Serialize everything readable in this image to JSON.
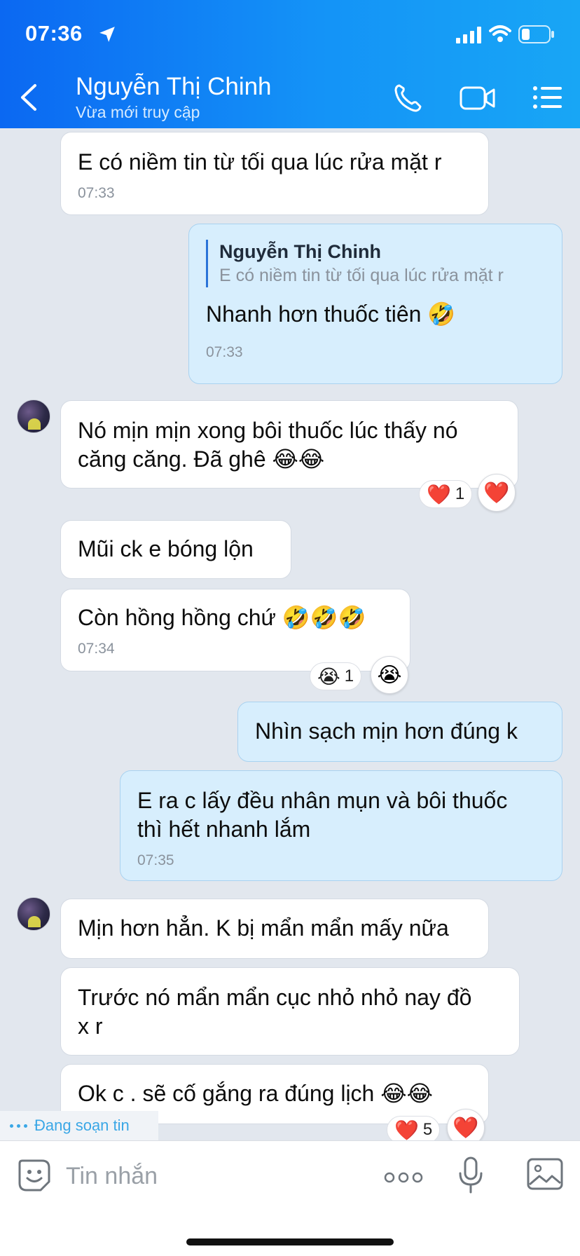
{
  "status_bar": {
    "time": "07:36"
  },
  "header": {
    "contact_name": "Nguyễn Thị Chinh",
    "contact_status": "Vừa mới truy cập"
  },
  "messages": [
    {
      "id": "m1",
      "direction": "incoming",
      "text": "E có niềm tin từ tối qua lúc rửa mặt r",
      "time": "07:33"
    },
    {
      "id": "m2",
      "direction": "outgoing",
      "quote": {
        "name": "Nguyễn Thị Chinh",
        "text": "E có niềm tin từ tối qua lúc rửa mặt r"
      },
      "text": "Nhanh hơn thuốc tiên 🤣",
      "time": "07:33"
    },
    {
      "id": "m3",
      "direction": "incoming",
      "lines": [
        "Nó mịn mịn xong bôi thuốc lúc thấy nó",
        "căng căng.  Đã ghê 😂😂"
      ],
      "reaction": {
        "emoji": "❤️",
        "count": "1"
      }
    },
    {
      "id": "m4",
      "direction": "incoming",
      "text": "Mũi ck e bóng lộn"
    },
    {
      "id": "m5",
      "direction": "incoming",
      "text": "Còn hồng hồng chứ 🤣🤣🤣",
      "time": "07:34",
      "reaction": {
        "emoji": "😭",
        "count": "1"
      }
    },
    {
      "id": "m6",
      "direction": "outgoing",
      "text": "Nhìn sạch mịn hơn đúng k"
    },
    {
      "id": "m7",
      "direction": "outgoing",
      "lines": [
        "E ra c lấy đều nhân mụn và bôi thuốc",
        "thì hết nhanh lắm"
      ],
      "time": "07:35"
    },
    {
      "id": "m8",
      "direction": "incoming",
      "text": "Mịn hơn hẳn. K bị mẩn mẩn mấy nữa"
    },
    {
      "id": "m9",
      "direction": "incoming",
      "lines": [
        "Trước nó mẩn mẩn cục nhỏ nhỏ nay đồ",
        "x r"
      ]
    },
    {
      "id": "m10",
      "direction": "incoming",
      "text": "Ok c . sẽ cố gắng ra đúng lịch 😂😂",
      "reaction": {
        "emoji": "❤️",
        "count": "5"
      }
    }
  ],
  "typing_indicator": "Đang soạn tin",
  "input": {
    "placeholder": "Tin nhắn"
  },
  "icons": {
    "back": "back-chevron-icon",
    "call": "phone-icon",
    "video": "video-camera-icon",
    "menu": "list-menu-icon",
    "sticker": "sticker-smile-icon",
    "more": "more-dots-icon",
    "mic": "microphone-icon",
    "image": "image-gallery-icon"
  },
  "colors": {
    "header_start": "#0b68f2",
    "header_end": "#18a6f5",
    "outgoing_bubble": "#d7eefd",
    "incoming_bubble": "#ffffff",
    "background": "#e2e7ee",
    "typing": "#3aa7e6"
  }
}
